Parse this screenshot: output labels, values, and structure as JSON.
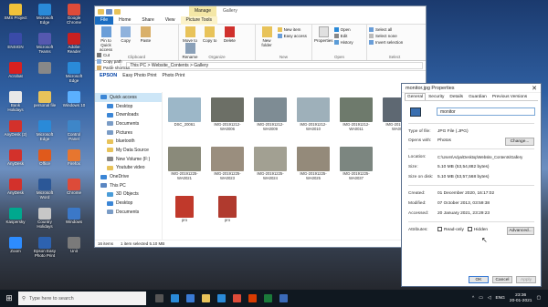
{
  "desktop": {
    "icons": [
      {
        "label": "SMS Project",
        "color": "#f0c23a"
      },
      {
        "label": "Microsoft Edge",
        "color": "#2a8ad8"
      },
      {
        "label": "Google Chrome",
        "color": "#dd4b39"
      },
      {
        "label": "ENSIGN",
        "color": "#3a4ba8"
      },
      {
        "label": "Microsoft Teams",
        "color": "#5558af"
      },
      {
        "label": "Adobe Reader",
        "color": "#c82020"
      },
      {
        "label": "Acrobat",
        "color": "#d92020"
      },
      {
        "label": "",
        "color": "#888"
      },
      {
        "label": "Microsoft Edge",
        "color": "#2a8ad8"
      },
      {
        "label": "Bank Holidays",
        "color": "#e8e8e8"
      },
      {
        "label": "personal file",
        "color": "#e8c35a"
      },
      {
        "label": "Windows 10",
        "color": "#5bb0ff"
      },
      {
        "label": "AnyDesk (2)",
        "color": "#d3312b"
      },
      {
        "label": "Microsoft Edge",
        "color": "#2a8ad8"
      },
      {
        "label": "Control Panel",
        "color": "#3e86c8"
      },
      {
        "label": "AnyDesk",
        "color": "#d3312b"
      },
      {
        "label": "Office",
        "color": "#e05a1c"
      },
      {
        "label": "Firefox",
        "color": "#e7762f"
      },
      {
        "label": "AnyDesk",
        "color": "#d3312b"
      },
      {
        "label": "Microsoft Word",
        "color": "#2b5797"
      },
      {
        "label": "Chrome",
        "color": "#dd4b39"
      },
      {
        "label": "Kaspersky",
        "color": "#00a88e"
      },
      {
        "label": "Country Holidays",
        "color": "#c7c7c7"
      },
      {
        "label": "Windows",
        "color": "#3b78c8"
      },
      {
        "label": "Zoom",
        "color": "#2d8cff"
      },
      {
        "label": "Epson Easy Photo Print",
        "color": "#2d62b0"
      },
      {
        "label": "Unit",
        "color": "#7a7a7a"
      }
    ]
  },
  "explorer": {
    "context_tab": "Manage",
    "title": "Gallery",
    "tabs": [
      "File",
      "Home",
      "Share",
      "View",
      "Picture Tools"
    ],
    "ribbon": {
      "clipboard": {
        "label": "Clipboard",
        "pin": "Pin to Quick access",
        "copy": "Copy",
        "paste": "Paste",
        "cut": "Cut",
        "copy_path": "Copy path",
        "paste_shortcut": "Paste shortcut"
      },
      "organize": {
        "label": "Organize",
        "move": "Move to",
        "copy": "Copy to",
        "delete": "Delete",
        "rename": "Rename"
      },
      "new": {
        "label": "New",
        "folder": "New folder",
        "new_item": "New item",
        "easy_access": "Easy access"
      },
      "open": {
        "label": "Open",
        "properties": "Properties",
        "open": "Open",
        "edit": "Edit",
        "history": "History"
      },
      "select": {
        "label": "Select",
        "all": "Select all",
        "none": "Select none",
        "invert": "Invert selection"
      }
    },
    "address": "This PC  >  Website_Contents  >  Gallery",
    "toolbar": {
      "brand": "EPSON",
      "easy": "Easy Photo Print",
      "photo": "Photo Print"
    },
    "nav": [
      {
        "label": "Quick access",
        "color": "#3b86d6",
        "sub": false,
        "sel": true
      },
      {
        "label": "Desktop",
        "color": "#3b86d6",
        "sub": true
      },
      {
        "label": "Downloads",
        "color": "#3b86d6",
        "sub": true
      },
      {
        "label": "Documents",
        "color": "#7a9cc6",
        "sub": true
      },
      {
        "label": "Pictures",
        "color": "#7a9cc6",
        "sub": true
      },
      {
        "label": "bluetooth",
        "color": "#e8c35a",
        "sub": true
      },
      {
        "label": "My Data Source",
        "color": "#e8c35a",
        "sub": true
      },
      {
        "label": "New Volume (F:)",
        "color": "#888",
        "sub": true
      },
      {
        "label": "Youtube video",
        "color": "#e8c35a",
        "sub": true
      },
      {
        "label": "OneDrive",
        "color": "#3b86d6",
        "sub": false
      },
      {
        "label": "This PC",
        "color": "#5a86c2",
        "sub": false
      },
      {
        "label": "3D Objects",
        "color": "#4a9cd8",
        "sub": true
      },
      {
        "label": "Desktop",
        "color": "#3b86d6",
        "sub": true
      },
      {
        "label": "Documents",
        "color": "#7a9cc6",
        "sub": true
      }
    ],
    "files": [
      {
        "name": "DSC_20061",
        "color": "#9cb7c8"
      },
      {
        "name": "IMG-20191212-WA0006",
        "color": "#6c6f66"
      },
      {
        "name": "IMG-20191212-WA0009",
        "color": "#7e8c94"
      },
      {
        "name": "IMG-20191212-WA0010",
        "color": "#9eb0ba"
      },
      {
        "name": "IMG-20191212-WA0011",
        "color": "#6e7a6c"
      },
      {
        "name": "IMG-20191212-WA0012",
        "color": "#5e6872"
      },
      {
        "name": "IMG-20191225-WA0021",
        "color": "#8a8a7a"
      },
      {
        "name": "IMG-20191225-WA0023",
        "color": "#9a8e7e"
      },
      {
        "name": "IMG-20191225-WA0024",
        "color": "#a2a092"
      },
      {
        "name": "IMG-20191225-WA0025",
        "color": "#948a7a"
      },
      {
        "name": "IMG-20191225-WA0037",
        "color": "#7c8680"
      },
      {
        "name": "",
        "color": ""
      },
      {
        "name": "pro",
        "color": "#c0392b"
      },
      {
        "name": "pro",
        "color": "#b03a2e"
      }
    ],
    "status": {
      "items": "16 items",
      "selected": "1 item selected  5.10 MB"
    }
  },
  "dialog": {
    "title": "monitor.jpg Properties",
    "close": "✕",
    "tabs": [
      "General",
      "Security",
      "Details",
      "Guardian",
      "Previous Versions"
    ],
    "name": "monitor",
    "type_label": "Type of file:",
    "type": "JPG File (.JPG)",
    "opens_label": "Opens with:",
    "opens": "Photos",
    "change": "Change...",
    "location_label": "Location:",
    "location": "C:\\Users\\Adya\\Desktop\\Website_Contents\\Gallery",
    "size_label": "Size:",
    "size": "5.10 MB (53,54,882 bytes)",
    "disk_label": "Size on disk:",
    "disk": "5.10 MB (53,57,568 bytes)",
    "created_label": "Created:",
    "created": "01 December 2020, 16:17:02",
    "modified_label": "Modified:",
    "modified": "07 October 2013, 03:59:38",
    "accessed_label": "Accessed:",
    "accessed": "20 January 2021, 23:29:23",
    "attr_label": "Attributes:",
    "readonly": "Read-only",
    "hidden": "Hidden",
    "advanced": "Advanced...",
    "ok": "OK",
    "cancel": "Cancel",
    "apply": "Apply"
  },
  "taskbar": {
    "search": "Type here to search",
    "lang": "ENG",
    "time": "23:36",
    "date": "20-01-2021",
    "apps": [
      "#555",
      "#2a8ad8",
      "#3a7bd5",
      "#e8c35a",
      "#2a8ad8",
      "#dd4b39",
      "#d83b01",
      "#1b7a3a",
      "#3b6ab8"
    ]
  }
}
